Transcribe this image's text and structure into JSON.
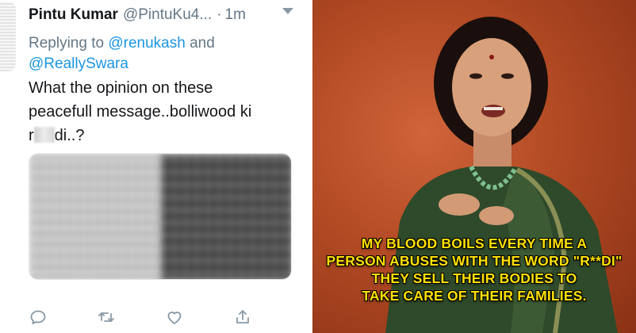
{
  "tweet": {
    "display_name": "Pintu Kumar",
    "handle": "@PintuKu4...",
    "time_separator": "·",
    "time": "1m",
    "reply_prefix": "Replying to",
    "reply_mentions": [
      "@renukash",
      "@ReallySwara"
    ],
    "reply_conjunction": "and",
    "text_lines": [
      "What the opinion on these",
      "peacefull message..bolliwood ki"
    ],
    "text_last_start": "r",
    "text_last_end": "di..?",
    "actions": [
      "reply-icon",
      "retweet-icon",
      "like-icon",
      "share-icon"
    ],
    "colors": {
      "name": "#14171a",
      "secondary": "#657786",
      "link": "#1b95e0"
    }
  },
  "video": {
    "caption_lines": [
      "MY BLOOD BOILS EVERY TIME A",
      "PERSON ABUSES WITH THE WORD \"R**DI\"",
      "THEY SELL THEIR BODIES TO",
      "TAKE CARE OF THEIR FAMILIES."
    ],
    "caption_color": "#ffe000",
    "background_color": "#b24a24"
  }
}
